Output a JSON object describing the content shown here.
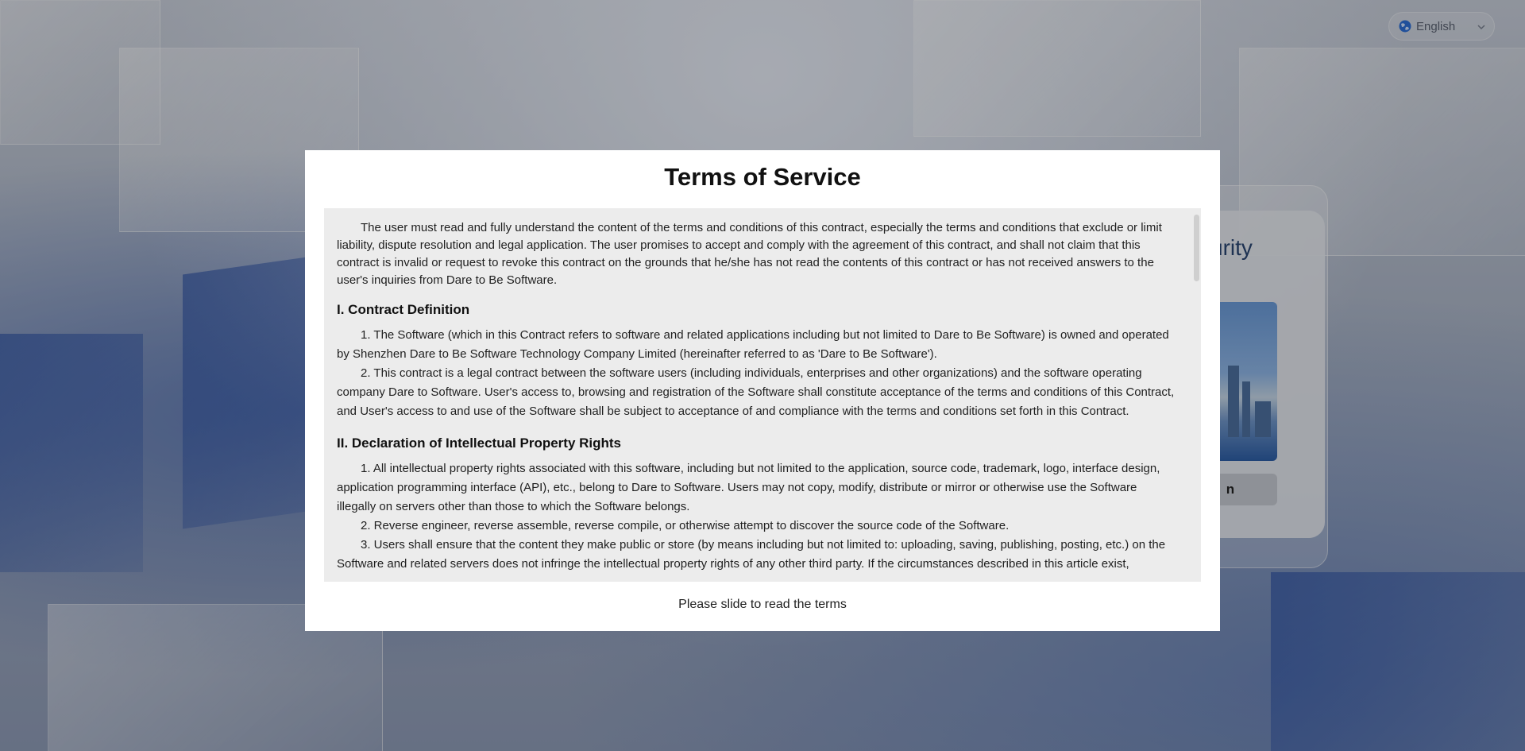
{
  "language_selector": {
    "label": "English",
    "globe_icon": "globe-icon",
    "chevron_icon": "chevron-down-icon"
  },
  "login": {
    "title_partial": "curity",
    "button_partial": "n"
  },
  "modal": {
    "title": "Terms of Service",
    "intro": "The user must read and fully understand the content of the terms and conditions of this contract, especially the terms and conditions that exclude or limit liability, dispute resolution and legal application. The user promises to accept and comply with the agreement of this contract, and shall not claim that this contract is invalid or request to revoke this contract on the grounds that he/she has not read the contents of this contract or has not received answers to the user's inquiries from Dare to Be Software.",
    "sections": [
      {
        "heading": "I. Contract Definition",
        "items": [
          "1. The Software (which in this Contract refers to software and related applications including but not limited to Dare to Be Software) is owned and operated by Shenzhen Dare to Be Software Technology Company Limited (hereinafter referred to as 'Dare to Be Software').",
          "2. This contract is a legal contract between the software users (including individuals, enterprises and other organizations) and the software operating company Dare to Software. User's access to, browsing and registration of the Software shall constitute acceptance of the terms and conditions of this Contract, and User's access to and use of the Software shall be subject to acceptance of and compliance with the terms and conditions set forth in this Contract."
        ]
      },
      {
        "heading": "II. Declaration of Intellectual Property Rights",
        "items": [
          "1. All intellectual property rights associated with this software, including but not limited to the application, source code, trademark, logo, interface design, application programming interface (API), etc., belong to Dare to Software. Users may not copy, modify, distribute or mirror or otherwise use the Software illegally on servers other than those to which the Software belongs.",
          "2. Reverse engineer, reverse assemble, reverse compile, or otherwise attempt to discover the source code of the Software.",
          "3. Users shall ensure that the content they make public or store (by means including but not limited to: uploading, saving, publishing, posting, etc.) on the Software and related servers does not infringe the intellectual property rights of any other third party. If the circumstances described in this article exist,"
        ]
      }
    ],
    "footer": "Please slide to read the terms"
  }
}
